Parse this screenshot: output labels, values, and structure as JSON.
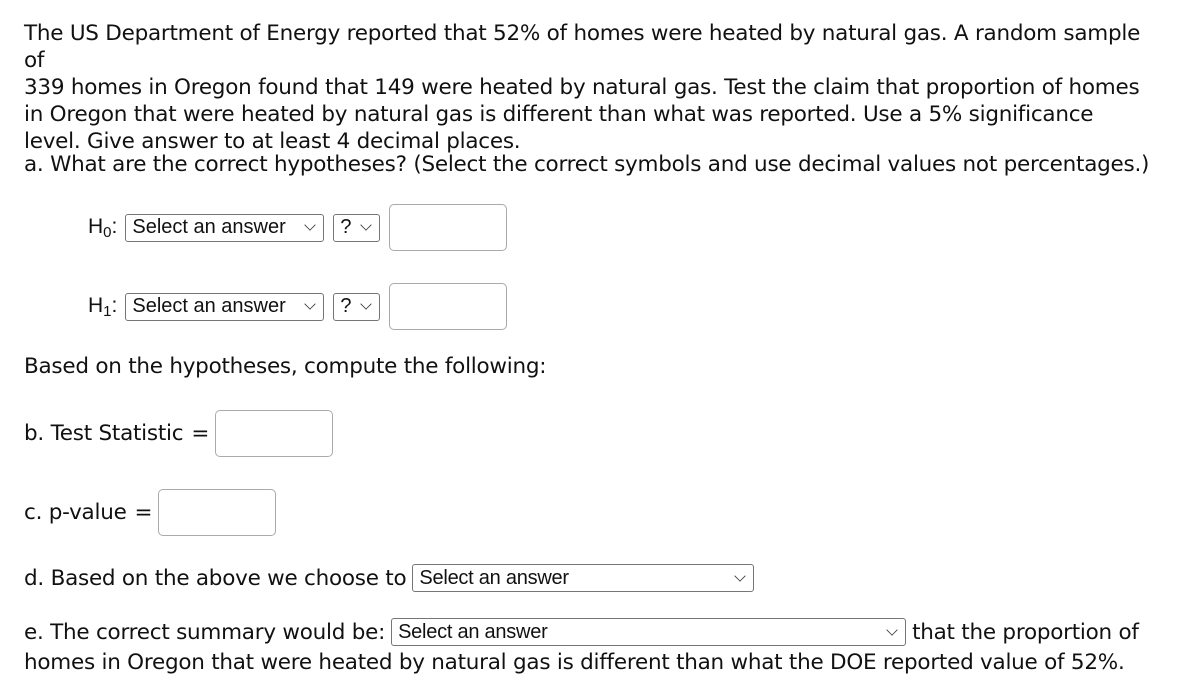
{
  "problem": {
    "line1": "The US Department of Energy reported that 52% of homes were heated by natural gas. A random sample of",
    "line2": "339 homes in Oregon found that 149 were heated by natural gas. Test the claim that proportion of homes",
    "line3": "in Oregon that were heated by natural gas is different than what was reported. Use a 5% significance",
    "line4": "level. Give answer to at least 4 decimal places."
  },
  "part_a": {
    "question": "a. What are the correct hypotheses? (Select the correct symbols and use decimal values not percentages.)",
    "h0": {
      "label": "H",
      "sub": "0",
      "colon": ":",
      "parameter_select": "Select an answer",
      "operator_select": "?",
      "value": ""
    },
    "h1": {
      "label": "H",
      "sub": "1",
      "colon": ":",
      "parameter_select": "Select an answer",
      "operator_select": "?",
      "value": ""
    }
  },
  "compute_intro": "Based on the hypotheses, compute the following:",
  "part_b": {
    "label": "b. Test Statistic",
    "equals": "=",
    "value": ""
  },
  "part_c": {
    "label": "c. p-value",
    "equals": "=",
    "value": ""
  },
  "part_d": {
    "label": "d. Based on the above we choose to",
    "select": "Select an answer"
  },
  "part_e": {
    "label": "e. The correct summary would be:",
    "select": "Select an answer",
    "after": "that the proportion of",
    "line2": "homes in Oregon that were heated by natural gas is different than what the DOE reported value of 52%."
  }
}
